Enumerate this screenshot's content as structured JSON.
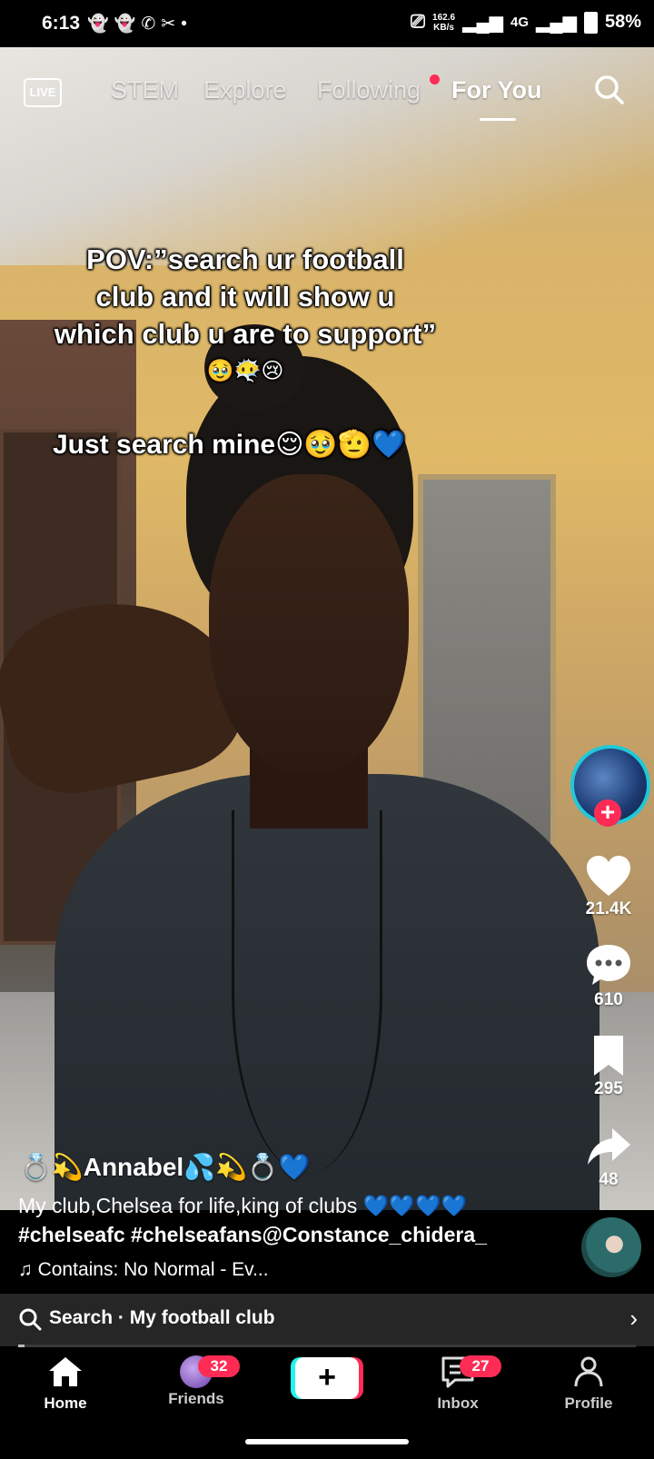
{
  "status_bar": {
    "time": "6:13",
    "notification_icons": "snapchat-icon snapchat-icon whatsapp-icon capcut-icon dot",
    "speed_value": "162.6",
    "speed_unit": "KB/s",
    "network": "4G",
    "battery": "58%"
  },
  "top_nav": {
    "live_label": "LIVE",
    "tabs": [
      {
        "label": "STEM",
        "active": false
      },
      {
        "label": "Explore",
        "active": false
      },
      {
        "label": "Following",
        "active": false,
        "has_dot": true
      },
      {
        "label": "For You",
        "active": true
      }
    ]
  },
  "video": {
    "caption_lines": [
      "POV:”search ur football",
      "club and it will show u",
      "which club u are to support”",
      "🥹😶‍🌫️😢"
    ],
    "caption_second": "Just search mine😌🥹🫡💙"
  },
  "right_rail": {
    "likes": "21.4K",
    "comments": "610",
    "saves": "295",
    "shares": "48"
  },
  "post": {
    "username": "💍💫Annabel💦💫💍💙",
    "description": "My club,Chelsea for life,king of clubs 💙💙💙💙",
    "hashtags": "#chelseafc #chelseafans@Constance_chidera_",
    "music": "♫ Contains: No Normal - Ev..."
  },
  "search_suggestion": {
    "label": "Search · My football club",
    "progress_fraction": 0.01
  },
  "bottom_nav": {
    "items": [
      {
        "label": "Home",
        "active": true
      },
      {
        "label": "Friends",
        "badge": "32"
      },
      {
        "label": "",
        "icon": "plus-icon"
      },
      {
        "label": "Inbox",
        "badge": "27"
      },
      {
        "label": "Profile"
      }
    ]
  },
  "colors": {
    "accent": "#fe2c55",
    "cyan": "#25f4ee",
    "suggestion_bg": "#262626"
  }
}
